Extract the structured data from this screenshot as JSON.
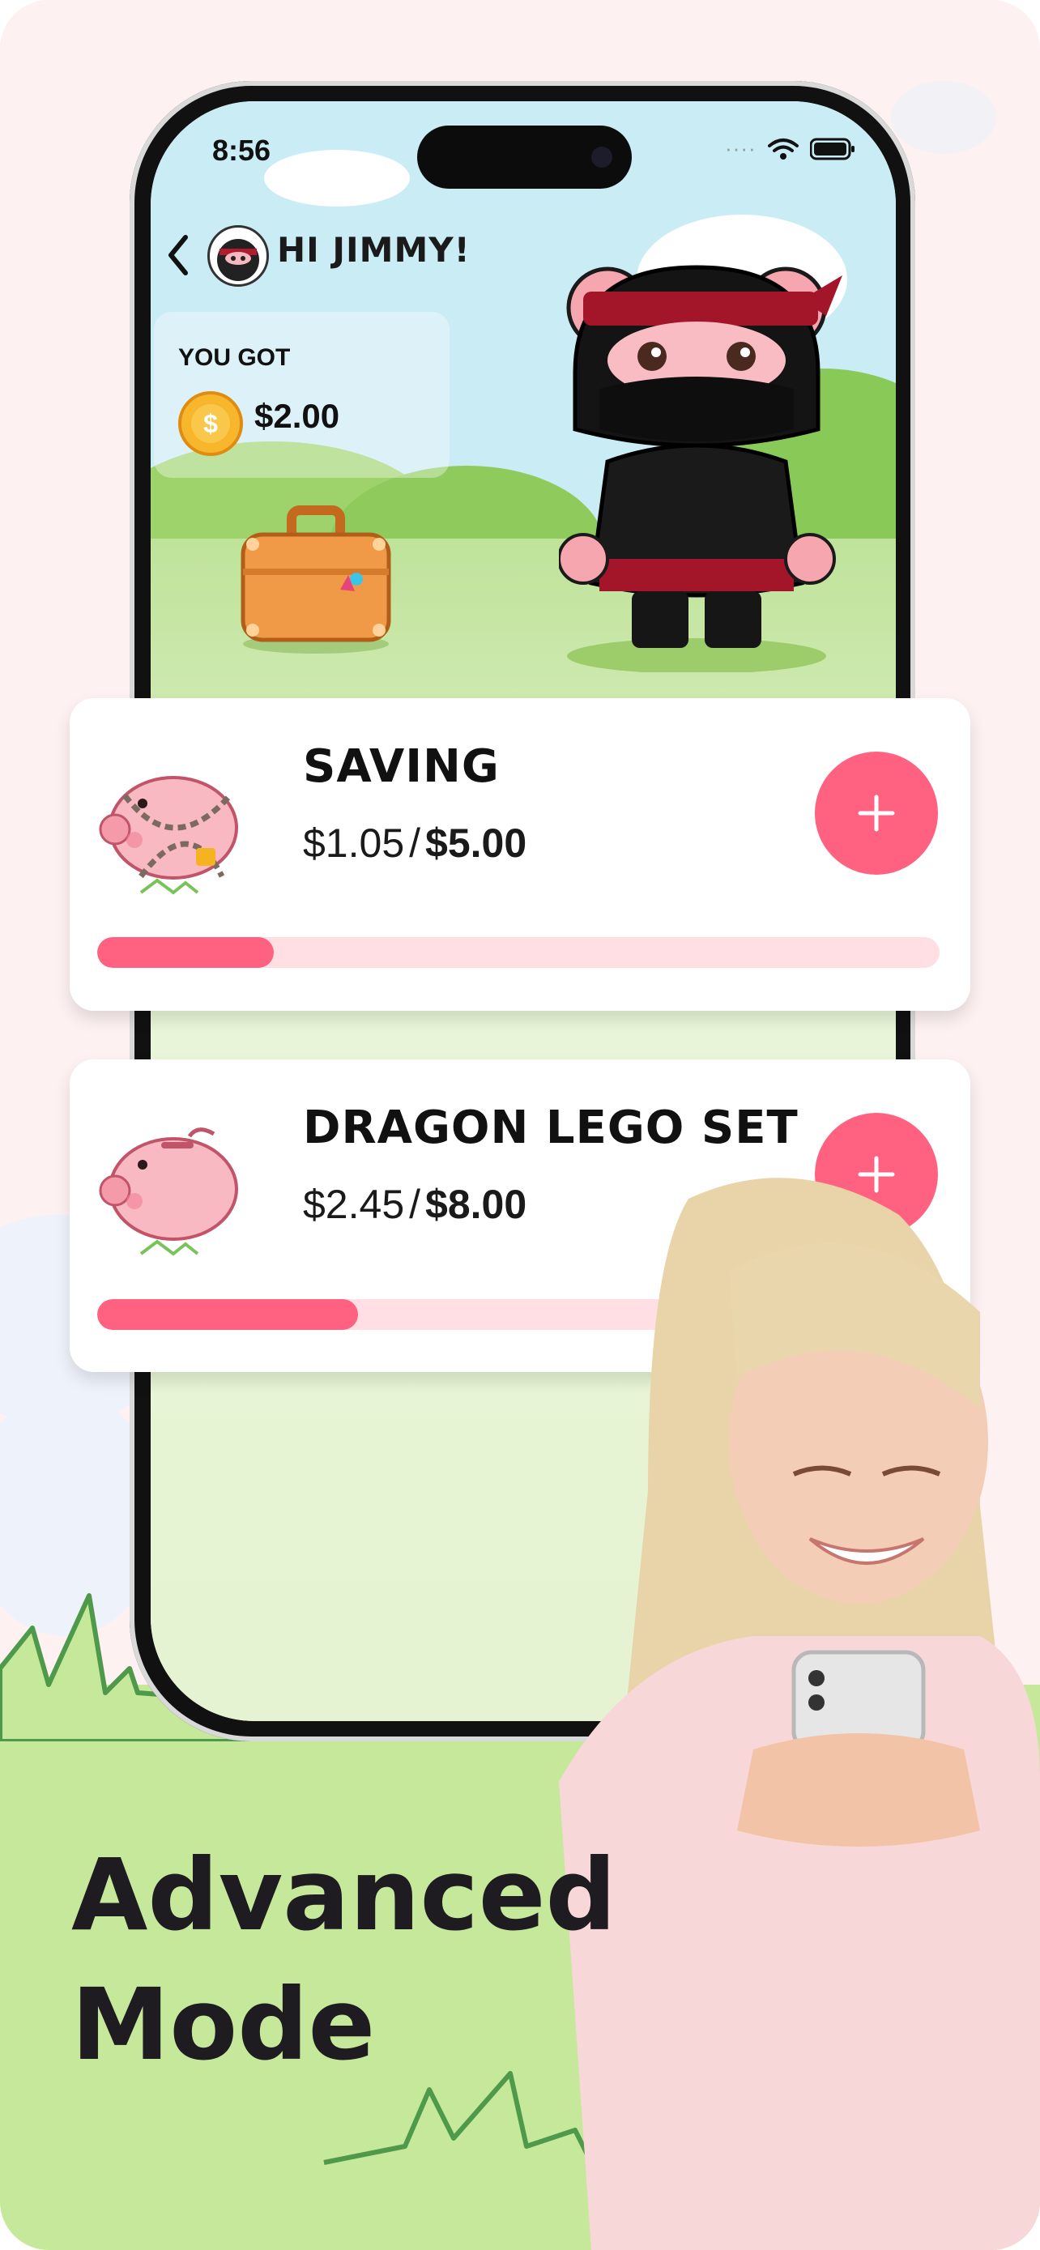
{
  "status_bar": {
    "time": "8:56"
  },
  "header": {
    "greeting": "HI JIMMY!"
  },
  "balance": {
    "label": "YOU GOT",
    "amount": "$2.00",
    "coin_symbol": "$"
  },
  "goals": [
    {
      "name": "SAVING",
      "current": "$1.05",
      "separator": "/",
      "target": "$5.00",
      "progress": 0.21,
      "locked": true
    },
    {
      "name": "DRAGON LEGO SET",
      "current": "$2.45",
      "separator": "/",
      "target": "$8.00",
      "progress": 0.31,
      "locked": false
    }
  ],
  "headline": {
    "line1": "Advanced",
    "line2": "Mode"
  },
  "colors": {
    "accent": "#ff6180",
    "accent_light": "#ffdfe4",
    "grass": "#c5e89a",
    "sky": "#c9ecf5"
  },
  "icons": {
    "back": "chevron-left-icon",
    "add": "plus-icon",
    "coin": "coin-icon"
  }
}
